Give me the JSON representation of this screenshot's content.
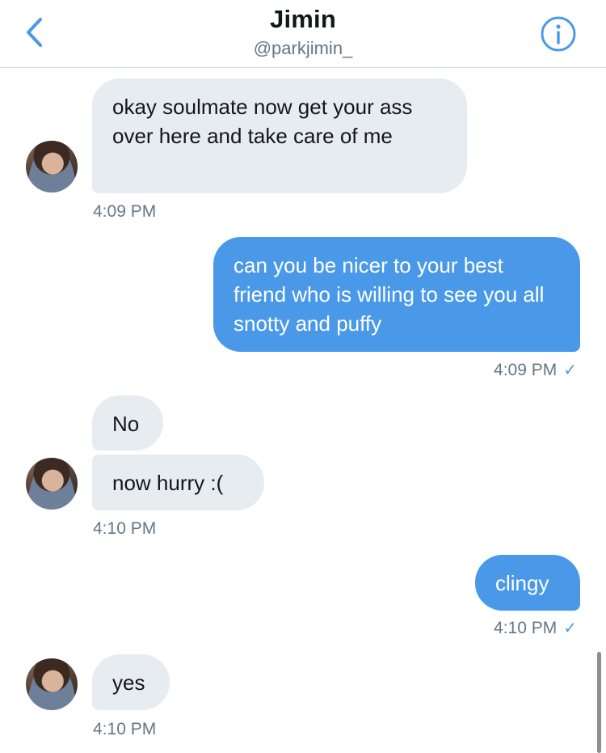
{
  "header": {
    "title": "Jimin",
    "handle": "@parkjimin_"
  },
  "messages": [
    {
      "sender": "them",
      "text": "okay soulmate now get your ass over here and take care of me",
      "time": "4:09 PM"
    },
    {
      "sender": "me",
      "text": "can you be nicer to your best friend who is willing to see you all snotty and puffy",
      "time": "4:09 PM",
      "status": "✓"
    },
    {
      "sender": "them",
      "text": "No"
    },
    {
      "sender": "them",
      "text": "now hurry :(",
      "time": "4:10 PM"
    },
    {
      "sender": "me",
      "text": "clingy",
      "time": "4:10 PM",
      "status": "✓"
    },
    {
      "sender": "them",
      "text": "yes",
      "time": "4:10 PM"
    }
  ],
  "colors": {
    "accent": "#4a99e9",
    "incoming_bubble": "#e6ecf0",
    "text": "#14171a",
    "secondary_text": "#657786"
  },
  "icons": {
    "back": "chevron-left-icon",
    "info": "info-circle-icon",
    "read": "checkmark-icon"
  }
}
